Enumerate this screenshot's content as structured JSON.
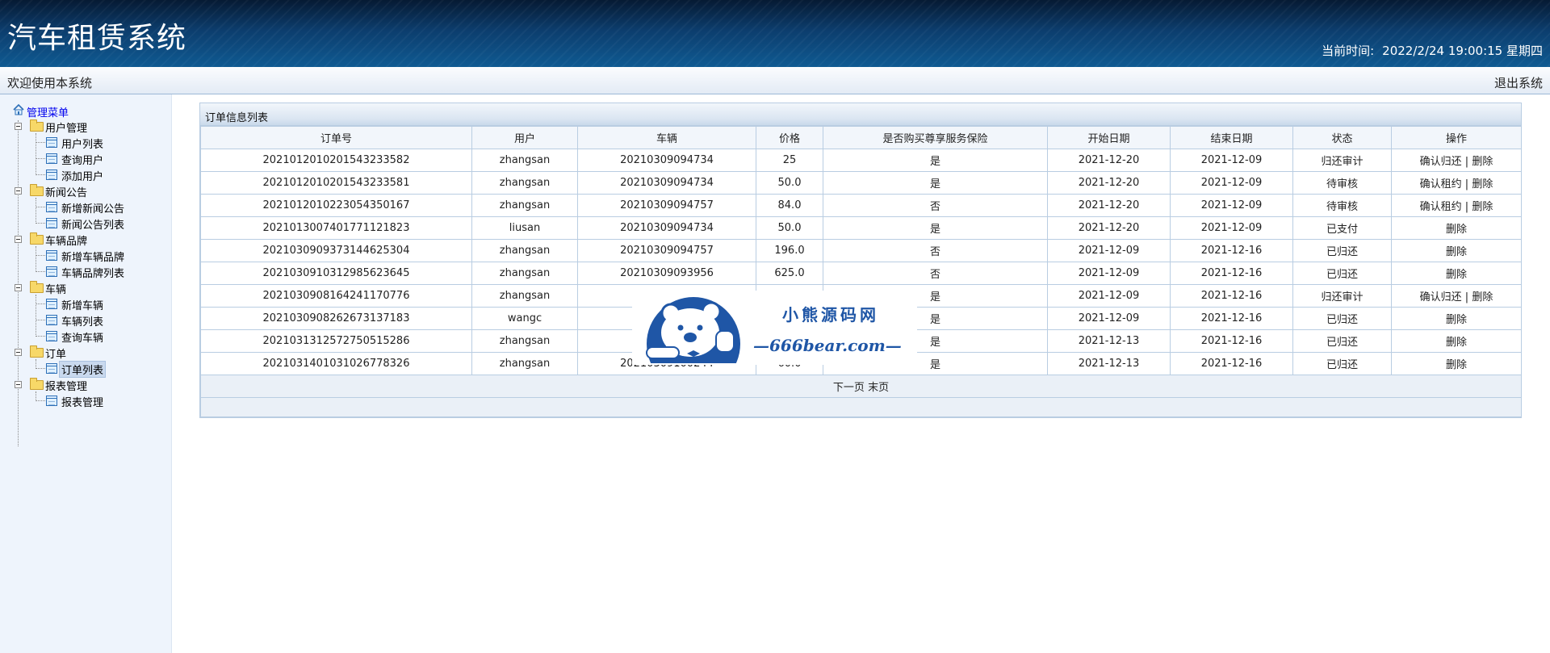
{
  "header": {
    "title": "汽车租赁系统",
    "clock_label": "当前时间:",
    "clock_value": "2022/2/24 19:00:15 星期四"
  },
  "topbar": {
    "welcome": "欢迎使用本系统",
    "logout": "退出系统"
  },
  "sidebar": {
    "root": "管理菜单",
    "groups": [
      {
        "label": "用户管理",
        "items": [
          "用户列表",
          "查询用户",
          "添加用户"
        ]
      },
      {
        "label": "新闻公告",
        "items": [
          "新增新闻公告",
          "新闻公告列表"
        ]
      },
      {
        "label": "车辆品牌",
        "items": [
          "新增车辆品牌",
          "车辆品牌列表"
        ]
      },
      {
        "label": "车辆",
        "items": [
          "新增车辆",
          "车辆列表",
          "查询车辆"
        ]
      },
      {
        "label": "订单",
        "items": [
          "订单列表"
        ]
      },
      {
        "label": "报表管理",
        "items": [
          "报表管理"
        ]
      }
    ],
    "selected": "订单列表"
  },
  "panel": {
    "title": "订单信息列表",
    "columns": [
      "订单号",
      "用户",
      "车辆",
      "价格",
      "是否购买尊享服务保险",
      "开始日期",
      "结束日期",
      "状态",
      "操作"
    ],
    "rows": [
      {
        "order": "20210120102015432335​82",
        "user": "zhangsan",
        "car": "20210309094734",
        "price": "25",
        "insurance": "是",
        "start": "2021-12-20",
        "end": "2021-12-09",
        "status": "归还审计",
        "ops": [
          "确认归还",
          "删除"
        ]
      },
      {
        "order": "20210120102015432335​81",
        "user": "zhangsan",
        "car": "20210309094734",
        "price": "50.0",
        "insurance": "是",
        "start": "2021-12-20",
        "end": "2021-12-09",
        "status": "待审核",
        "ops": [
          "确认租约",
          "删除"
        ]
      },
      {
        "order": "20210120102230543501​67",
        "user": "zhangsan",
        "car": "20210309094757",
        "price": "84.0",
        "insurance": "否",
        "start": "2021-12-20",
        "end": "2021-12-09",
        "status": "待审核",
        "ops": [
          "确认租约",
          "删除"
        ]
      },
      {
        "order": "20210130074017711218​23",
        "user": "liusan",
        "car": "20210309094734",
        "price": "50.0",
        "insurance": "是",
        "start": "2021-12-20",
        "end": "2021-12-09",
        "status": "已支付",
        "ops": [
          "删除"
        ]
      },
      {
        "order": "20210309093731446253​04",
        "user": "zhangsan",
        "car": "20210309094757",
        "price": "196.0",
        "insurance": "否",
        "start": "2021-12-09",
        "end": "2021-12-16",
        "status": "已归还",
        "ops": [
          "删除"
        ]
      },
      {
        "order": "20210309103129856236​45",
        "user": "zhangsan",
        "car": "20210309093956",
        "price": "625.0",
        "insurance": "否",
        "start": "2021-12-09",
        "end": "2021-12-16",
        "status": "已归还",
        "ops": [
          "删除"
        ]
      },
      {
        "order": "20210309081642411707​76",
        "user": "zhangsan",
        "car": "20",
        "price": "",
        "insurance": "是",
        "start": "2021-12-09",
        "end": "2021-12-16",
        "status": "归还审计",
        "ops": [
          "确认归还",
          "删除"
        ]
      },
      {
        "order": "20210309082626731371​83",
        "user": "wangc",
        "car": "20",
        "price": "",
        "insurance": "是",
        "start": "2021-12-09",
        "end": "2021-12-16",
        "status": "已归还",
        "ops": [
          "删除"
        ]
      },
      {
        "order": "20210313125727505152​86",
        "user": "zhangsan",
        "car": "20",
        "price": "",
        "insurance": "是",
        "start": "2021-12-13",
        "end": "2021-12-16",
        "status": "已归还",
        "ops": [
          "删除"
        ]
      },
      {
        "order": "20210314010310267783​26",
        "user": "zhangsan",
        "car": "20210309100244",
        "price": "60.0",
        "insurance": "是",
        "start": "2021-12-13",
        "end": "2021-12-16",
        "status": "已归还",
        "ops": [
          "删除"
        ]
      }
    ],
    "pager": {
      "next": "下一页",
      "last": "末页"
    }
  },
  "watermark": {
    "cn": "小熊源码网",
    "en": "—666bear.com—"
  }
}
